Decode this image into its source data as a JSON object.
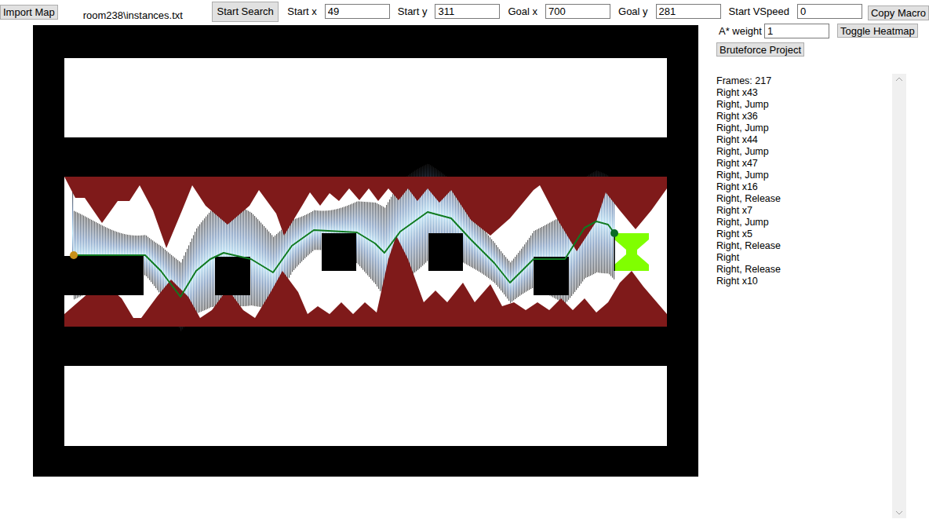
{
  "toolbar": {
    "import_button": "Import Map",
    "file_label": "room238\\instances.txt",
    "search_button": "Start Search",
    "fields": [
      {
        "label": "Start x",
        "value": "49"
      },
      {
        "label": "Start y",
        "value": "311"
      },
      {
        "label": "Goal x",
        "value": "700"
      },
      {
        "label": "Goal y",
        "value": "281"
      },
      {
        "label": "Start VSpeed",
        "value": "0"
      }
    ],
    "copy_button": "Copy Macro"
  },
  "options": {
    "weight_label": "A* weight",
    "weight_value": "1",
    "heatmap_button": "Toggle Heatmap",
    "bruteforce_button": "Bruteforce Project"
  },
  "map": {
    "heatmap_visible": true
  },
  "output": {
    "lines": [
      "Frames: 217",
      "Right x43",
      "Right, Jump",
      "Right x36",
      "Right, Jump",
      "Right x44",
      "Right, Jump",
      "Right x47",
      "Right, Jump",
      "Right x16",
      "Right, Release",
      "Right x7",
      "Right, Jump",
      "Right x5",
      "Right, Release",
      "Right",
      "Right, Release",
      "Right x10"
    ]
  }
}
